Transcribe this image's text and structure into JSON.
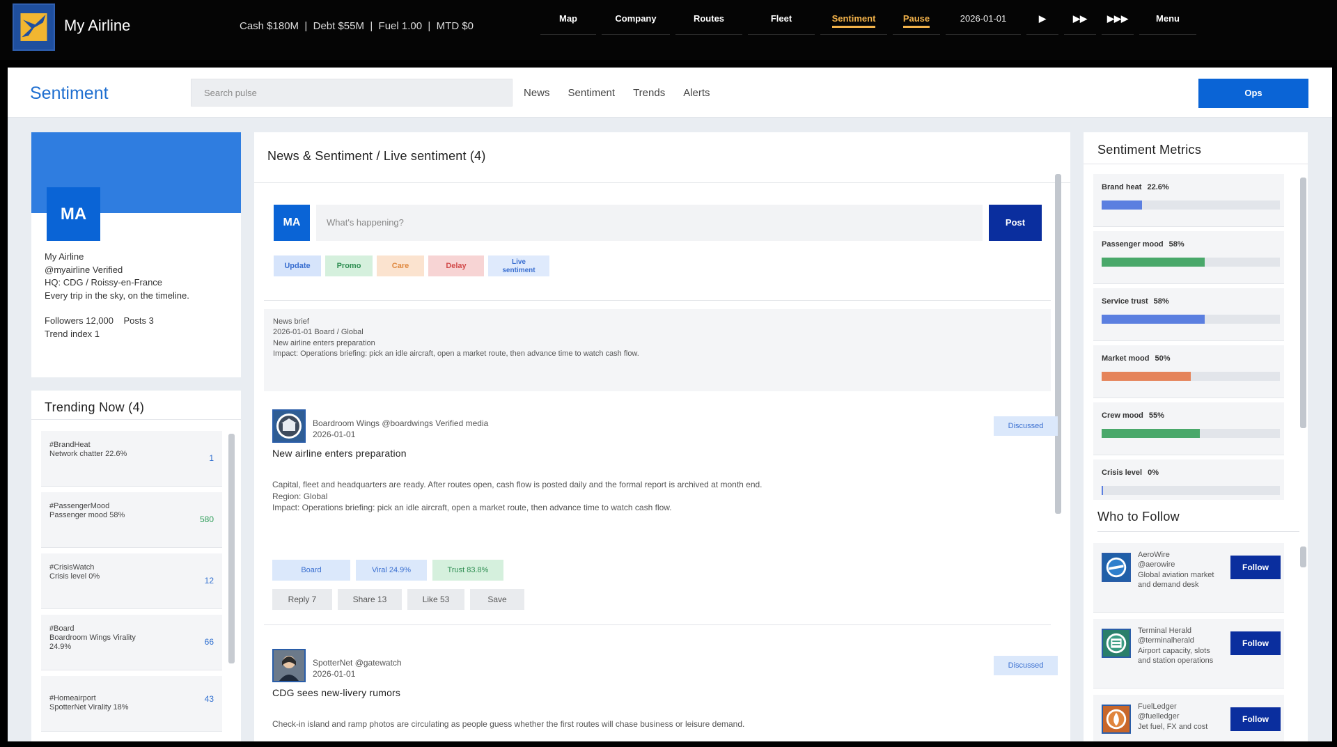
{
  "topbar": {
    "app_title": "My Airline",
    "stats": "Cash $180M  |  Debt $55M  |  Fuel 1.00  |  MTD $0",
    "nav": [
      {
        "label": "Map",
        "icon": ""
      },
      {
        "label": "Company",
        "icon": ""
      },
      {
        "label": "Routes",
        "icon": ""
      },
      {
        "label": "Fleet",
        "icon": ""
      },
      {
        "label": "Sentiment",
        "icon": ""
      },
      {
        "label": "Pause",
        "icon": ""
      },
      {
        "label": "2026-01-01",
        "icon": ""
      },
      {
        "label": "▶",
        "icon": "play-icon"
      },
      {
        "label": "▶▶",
        "icon": "fast-forward-icon"
      },
      {
        "label": "▶▶▶",
        "icon": "fastest-forward-icon"
      },
      {
        "label": "Menu",
        "icon": ""
      }
    ],
    "accent_color": "#f2b24a"
  },
  "header": {
    "title": "Sentiment",
    "search_placeholder": "Search pulse",
    "tabs": [
      "News",
      "Sentiment",
      "Trends",
      "Alerts"
    ],
    "ops_label": "Ops"
  },
  "profile": {
    "avatar": "MA",
    "name": "My Airline",
    "handle": "@myairline  Verified",
    "hq": "HQ: CDG / Roissy-en-France",
    "bio": "Every trip in the sky, on the timeline.",
    "followers": "Followers 12,000",
    "posts": "Posts 3",
    "trend_index": "Trend index 1"
  },
  "trending": {
    "title": "Trending Now (4)",
    "items": [
      {
        "tag": "#BrandHeat",
        "desc": "Network chatter 22.6%",
        "desc2": "",
        "count": "1"
      },
      {
        "tag": "#PassengerMood",
        "desc": "Passenger mood 58%",
        "desc2": "",
        "count": "580"
      },
      {
        "tag": "#CrisisWatch",
        "desc": "Crisis level 0%",
        "desc2": "",
        "count": "12"
      },
      {
        "tag": "#Board",
        "desc": "Boardroom Wings  Virality",
        "desc2": "24.9%",
        "count": "66"
      },
      {
        "tag": "#Homeairport",
        "desc": "SpotterNet  Virality 18%",
        "desc2": "",
        "count": "43"
      }
    ]
  },
  "feed": {
    "heading": "News & Sentiment  /  Live sentiment  (4)",
    "compose": {
      "avatar": "MA",
      "placeholder": "What's happening?",
      "post_label": "Post",
      "chips": [
        "Update",
        "Promo",
        "Care",
        "Delay",
        "Live",
        "sentiment"
      ]
    },
    "brief": {
      "label": "News brief",
      "meta": "2026-01-01  Board / Global",
      "headline": "New airline enters preparation",
      "impact": "Impact: Operations briefing: pick an idle aircraft, open a market route, then advance time to watch cash flow."
    },
    "posts": [
      {
        "author": "Boardroom Wings  @boardwings  Verified media",
        "date": "2026-01-01",
        "badge": "Discussed",
        "title": "New airline enters preparation",
        "body1": "Capital, fleet and headquarters are ready. After routes open, cash flow is posted daily and the formal report is archived at month end.",
        "body2": "Region: Global",
        "body3": "Impact: Operations briefing: pick an idle aircraft, open a market route, then advance time to watch cash flow.",
        "tags": [
          "Board",
          "Viral 24.9%",
          "Trust 83.8%"
        ],
        "actions": [
          "Reply 7",
          "Share 13",
          "Like 53",
          "Save"
        ]
      },
      {
        "author": "SpotterNet  @gatewatch",
        "date": "2026-01-01",
        "badge": "Discussed",
        "title": "CDG sees new-livery rumors",
        "body1": "Check-in island and ramp photos are circulating as people guess whether the first routes will chase business or leisure demand."
      }
    ]
  },
  "metrics": {
    "title": "Sentiment Metrics",
    "items": [
      {
        "label": "Brand heat",
        "pct": "22.6%",
        "value": 0.226,
        "color": "#5b7fe0"
      },
      {
        "label": "Passenger mood",
        "pct": "58%",
        "value": 0.58,
        "color": "#49a86a"
      },
      {
        "label": "Service trust",
        "pct": "58%",
        "value": 0.58,
        "color": "#5b7fe0"
      },
      {
        "label": "Market mood",
        "pct": "50%",
        "value": 0.5,
        "color": "#e5845a"
      },
      {
        "label": "Crew mood",
        "pct": "55%",
        "value": 0.55,
        "color": "#49a86a"
      },
      {
        "label": "Crisis level",
        "pct": "0%",
        "value": 0.0,
        "color": "#5b7fe0"
      }
    ]
  },
  "follow": {
    "title": "Who to Follow",
    "items": [
      {
        "name": "AeroWire",
        "handle": "@aerowire",
        "desc": "Global aviation market and demand desk",
        "button": "Follow"
      },
      {
        "name": "Terminal Herald",
        "handle": "@terminalherald",
        "desc": "Airport capacity, slots and station operations",
        "button": "Follow"
      },
      {
        "name": "FuelLedger",
        "handle": "@fuelledger",
        "desc": "Jet fuel, FX and cost",
        "button": "Follow"
      }
    ]
  }
}
